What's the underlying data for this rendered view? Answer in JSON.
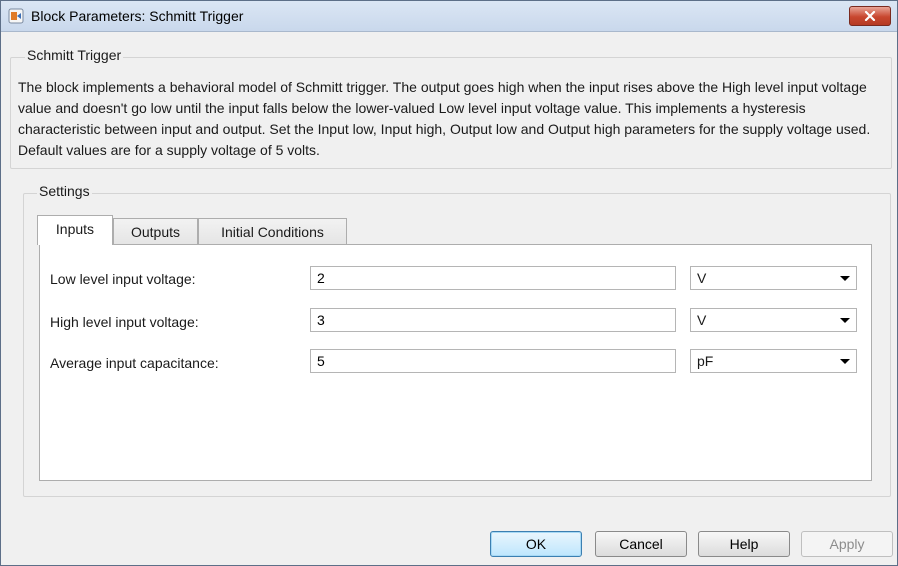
{
  "window": {
    "title": "Block Parameters: Schmitt Trigger"
  },
  "block_group": {
    "title": "Schmitt Trigger",
    "description": "The block implements a behavioral model of Schmitt trigger. The output goes high when the input rises above the High level input voltage value and doesn't go low until the input falls below the lower-valued Low level input voltage value. This implements a hysteresis characteristic between input and output. Set the Input low, Input high, Output low and Output high parameters for the supply voltage used. Default values are for a supply voltage of 5 volts."
  },
  "settings": {
    "title": "Settings",
    "tabs": [
      {
        "label": "Inputs",
        "active": true
      },
      {
        "label": "Outputs",
        "active": false
      },
      {
        "label": "Initial Conditions",
        "active": false
      }
    ],
    "params": [
      {
        "label": "Low level input voltage:",
        "value": "2",
        "unit": "V"
      },
      {
        "label": "High level input voltage:",
        "value": "3",
        "unit": "V"
      },
      {
        "label": "Average input capacitance:",
        "value": "5",
        "unit": "pF"
      }
    ]
  },
  "buttons": {
    "ok": "OK",
    "cancel": "Cancel",
    "help": "Help",
    "apply": "Apply"
  },
  "colors": {
    "close_button": "#c8472f",
    "default_button_border": "#3c7fb1"
  }
}
